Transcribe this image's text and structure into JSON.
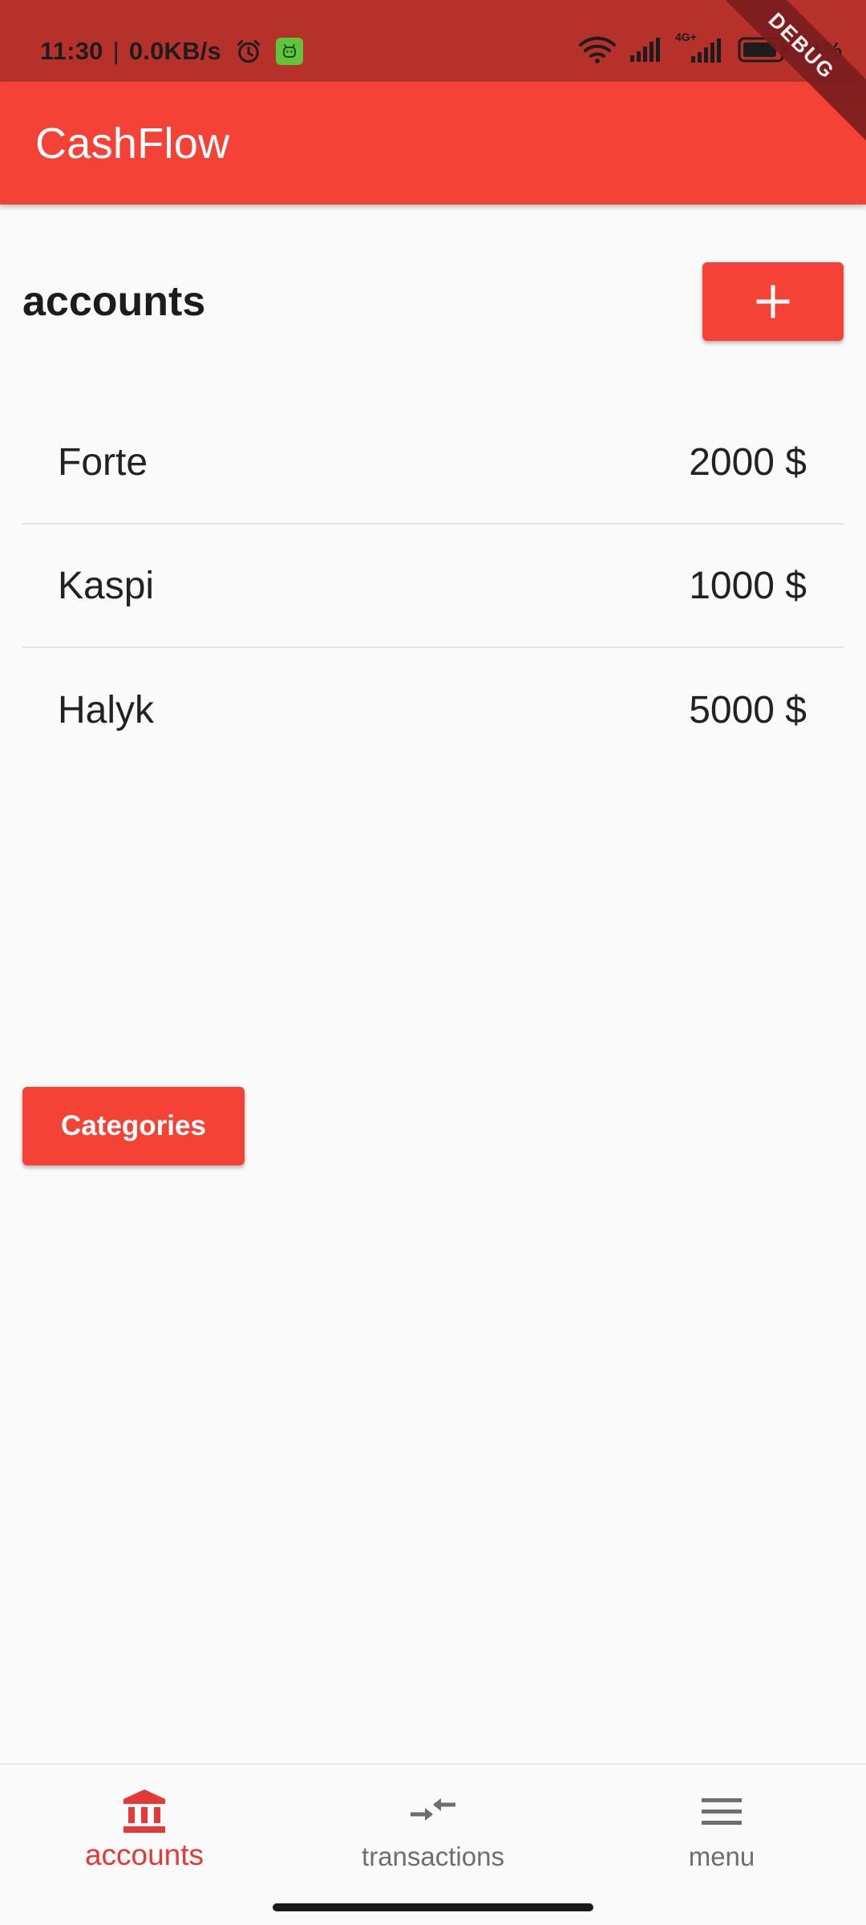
{
  "status_bar": {
    "time": "11:30",
    "separator": "|",
    "speed": "0.0KB/s",
    "alarm_icon": "alarm-clock-icon",
    "app_badge_icon": "android-app-icon",
    "network_label": "4G+",
    "battery": "81%"
  },
  "debug_banner": "DEBUG",
  "app_bar": {
    "title": "CashFlow"
  },
  "accounts_section": {
    "title": "accounts",
    "add_icon": "plus-icon"
  },
  "accounts": [
    {
      "name": "Forte",
      "balance": "2000 $"
    },
    {
      "name": "Kaspi",
      "balance": "1000 $"
    },
    {
      "name": "Halyk",
      "balance": "5000 $"
    }
  ],
  "categories_button": {
    "label": "Categories"
  },
  "bottom_nav": {
    "items": [
      {
        "label": "accounts",
        "icon": "bank-icon",
        "active": true
      },
      {
        "label": "transactions",
        "icon": "swap-arrows-icon",
        "active": false
      },
      {
        "label": "menu",
        "icon": "hamburger-menu-icon",
        "active": false
      }
    ]
  },
  "colors": {
    "primary": "#f44336",
    "status_bar": "#b7312b",
    "active_nav": "#e53935",
    "inactive_nav": "#6e6e6e",
    "background": "#fafafa"
  }
}
